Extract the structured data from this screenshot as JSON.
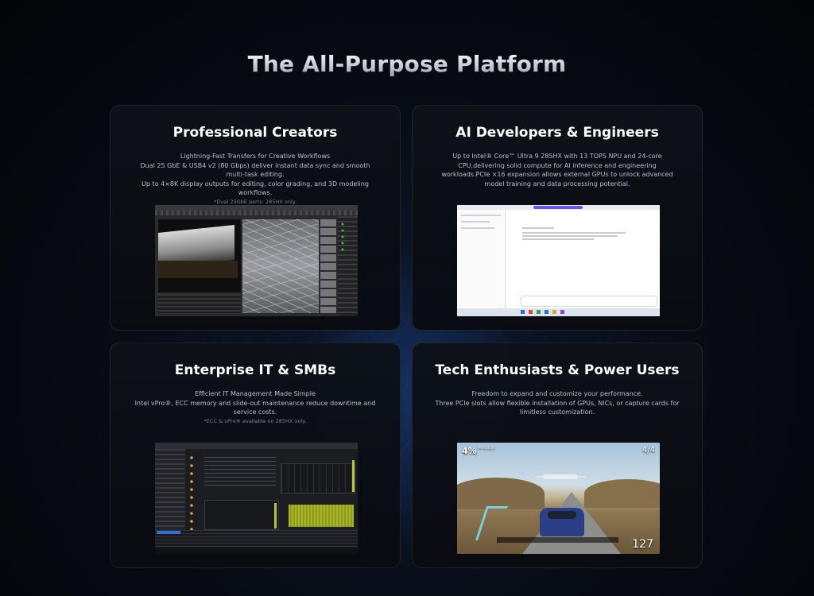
{
  "page": {
    "title": "The All-Purpose Platform"
  },
  "cards": [
    {
      "title": "Professional Creators",
      "lines": [
        "Lightning-Fast Transfers for Creative Workflows",
        "Dual 25 GbE & USB4 v2 (80 Gbps) deliver instant data sync and smooth multi-task editing.",
        "Up to 4×8K display outputs for editing, color grading, and 3D modeling workflows."
      ],
      "note": "*Dual 25GbE ports: 285HX only.",
      "screenshot": "3d-modeling-app"
    },
    {
      "title": "AI Developers & Engineers",
      "lines": [
        "Up to Intel® Core™ Ultra 9 285HX with 13 TOPS NPU and 24-core CPU,delivering solid compute for AI inference and engineering workloads.PCIe ×16 expansion allows external GPUs to unlock advanced model training and data processing potential."
      ],
      "note": "",
      "screenshot": "ai-chat-app"
    },
    {
      "title": "Enterprise IT & SMBs",
      "lines": [
        "Efficient IT Management Made Simple",
        "Intel vPro®, ECC memory and slide-out maintenance reduce downtime and service costs."
      ],
      "note": "*ECC & vPro® available on 285HX only.",
      "screenshot": "admin-console"
    },
    {
      "title": "Tech Enthusiasts & Power Users",
      "lines": [
        "Freedom to expand and customize your performance.",
        "Three PCIe slots allow flexible installation of GPUs, NICs, or capture cards for limitless customization."
      ],
      "note": "",
      "screenshot": "racing-game",
      "game_hud": {
        "percent": "4%",
        "progress": "PROGRESS",
        "position": "4/4",
        "speed": "127"
      }
    }
  ]
}
